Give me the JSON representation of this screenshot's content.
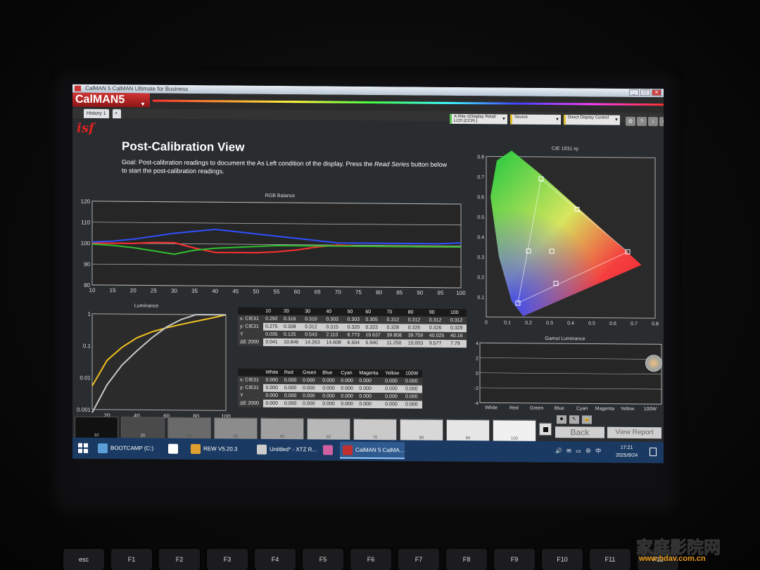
{
  "window": {
    "title": "CalMAN 5 CalMAN Ultimate for Business",
    "buttons": [
      "_",
      "□",
      "✕"
    ]
  },
  "logo": "CalMAN5",
  "tabs": [
    {
      "label": "History 1"
    },
    {
      "label": "+"
    }
  ],
  "toolbar": {
    "meter": "X-Rite i1Display Retail LCD (CCFL)",
    "source": "Source",
    "display": "Direct Display Control"
  },
  "isf_logo": "isf",
  "page_title": "Post-Calibration View",
  "goal": {
    "text_1": "Goal: Post-calibration readings to document the As Left condition of the display. Press the ",
    "em": "Read Series",
    "text_2": " button below to start the post-calibration readings."
  },
  "rgb_balance": {
    "title": "RGB Balance"
  },
  "luminance": {
    "title": "Luminance"
  },
  "cie": {
    "title": "CIE 1931 xy"
  },
  "gamut_luminance": {
    "title": "Gamut Luminance"
  },
  "chart_data": [
    {
      "type": "line",
      "title": "RGB Balance",
      "x": [
        10,
        15,
        20,
        25,
        30,
        35,
        40,
        45,
        50,
        55,
        60,
        65,
        70,
        75,
        80,
        85,
        90,
        95,
        100
      ],
      "ylim": [
        80,
        120
      ],
      "yticks": [
        80,
        90,
        100,
        110,
        120
      ],
      "grid": true,
      "series": [
        {
          "color": "#ff3030",
          "values": [
            100,
            100,
            100,
            100.5,
            100.5,
            98,
            96,
            96,
            96,
            96.5,
            97.5,
            99,
            100,
            99.5,
            99.5,
            99.5,
            99.5,
            99.5,
            99.5
          ]
        },
        {
          "color": "#30c030",
          "values": [
            99.5,
            99,
            98,
            96.5,
            95,
            97,
            98,
            98.5,
            99,
            99.5,
            99.5,
            99.5,
            99.5,
            99.5,
            99.5,
            99.5,
            99.5,
            99.5,
            99.5
          ]
        },
        {
          "color": "#3050ff",
          "values": [
            100.5,
            101,
            102,
            103.5,
            105,
            106,
            107,
            106,
            105,
            104,
            103,
            102,
            101,
            101,
            101,
            101,
            101,
            101,
            101.5
          ]
        }
      ]
    },
    {
      "type": "line",
      "title": "Luminance",
      "xlim": [
        10,
        100
      ],
      "xticks": [
        20,
        40,
        60,
        80,
        100
      ],
      "ylim": [
        0.001,
        1
      ],
      "yscale": "log",
      "yticks": [
        "0.001",
        "0.01",
        "0.1",
        "1"
      ],
      "series": [
        {
          "color": "#f0c020",
          "x": [
            10,
            20,
            30,
            40,
            50,
            60,
            70,
            80,
            90,
            100
          ],
          "values": [
            0.0055,
            0.035,
            0.09,
            0.18,
            0.28,
            0.38,
            0.49,
            0.62,
            0.78,
            1.0
          ]
        },
        {
          "color": "#c8c8c8",
          "x": [
            10,
            20,
            30,
            40,
            50,
            60,
            70,
            80,
            90,
            100
          ],
          "values": [
            0.0008,
            0.006,
            0.025,
            0.07,
            0.18,
            0.4,
            0.7,
            1.0,
            1.0,
            1.0
          ]
        }
      ]
    },
    {
      "type": "scatter",
      "title": "CIE 1931 xy",
      "xlim": [
        0,
        0.8
      ],
      "ylim": [
        0,
        0.8
      ],
      "xticks": [
        0,
        0.1,
        0.2,
        0.3,
        0.4,
        0.5,
        0.6,
        0.7,
        0.8
      ],
      "yticks": [
        0.1,
        0.2,
        0.3,
        0.4,
        0.5,
        0.6,
        0.7,
        0.8
      ],
      "points": [
        {
          "name": "R",
          "x": 0.67,
          "y": 0.33
        },
        {
          "name": "G",
          "x": 0.26,
          "y": 0.69
        },
        {
          "name": "B",
          "x": 0.15,
          "y": 0.07
        },
        {
          "name": "C",
          "x": 0.2,
          "y": 0.33
        },
        {
          "name": "M",
          "x": 0.33,
          "y": 0.17
        },
        {
          "name": "Y",
          "x": 0.43,
          "y": 0.54
        },
        {
          "name": "W",
          "x": 0.31,
          "y": 0.33
        }
      ]
    },
    {
      "type": "bar",
      "title": "Gamut Luminance",
      "categories": [
        "White",
        "Red",
        "Green",
        "Blue",
        "Cyan",
        "Magenta",
        "Yellow",
        "100W"
      ],
      "ylim": [
        -4,
        4
      ],
      "yticks": [
        -4,
        -2,
        0,
        2,
        4
      ],
      "values": [
        0,
        0,
        0,
        0,
        0,
        0,
        0,
        0
      ]
    }
  ],
  "grayscale_table": {
    "header": [
      "",
      "10",
      "20",
      "30",
      "40",
      "50",
      "60",
      "70",
      "80",
      "90",
      "100"
    ],
    "rows": [
      {
        "label": "x: CIE31",
        "style": "dk",
        "values": [
          "0.292",
          "0.316",
          "0.310",
          "0.303",
          "0.303",
          "0.305",
          "0.312",
          "0.312",
          "0.312",
          "0.312"
        ]
      },
      {
        "label": "y: CIE31",
        "style": "lt",
        "values": [
          "0.275",
          "0.308",
          "0.312",
          "0.315",
          "0.320",
          "0.323",
          "0.328",
          "0.326",
          "0.326",
          "0.329"
        ]
      },
      {
        "label": "Y",
        "style": "dk",
        "values": [
          "0.035",
          "0.125",
          "0.543",
          "2.110",
          "6.773",
          "19.637",
          "39.808",
          "39.759",
          "40.025",
          "40.16"
        ]
      },
      {
        "label": "ΔE 2000",
        "style": "lt",
        "values": [
          "3.041",
          "10.846",
          "14.263",
          "14.608",
          "6.504",
          "5.940",
          "11.250",
          "10.003",
          "9.577",
          "7.79"
        ]
      }
    ]
  },
  "color_table": {
    "header": [
      "",
      "White",
      "Red",
      "Green",
      "Blue",
      "Cyan",
      "Magenta",
      "Yellow",
      "100W"
    ],
    "rows": [
      {
        "label": "x: CIE31",
        "style": "dk",
        "values": [
          "0.000",
          "0.000",
          "0.000",
          "0.000",
          "0.000",
          "0.000",
          "0.000",
          "0.000"
        ]
      },
      {
        "label": "y: CIE31",
        "style": "lt",
        "values": [
          "0.000",
          "0.000",
          "0.000",
          "0.000",
          "0.000",
          "0.000",
          "0.000",
          "0.000"
        ]
      },
      {
        "label": "Y",
        "style": "dk",
        "values": [
          "0.000",
          "0.000",
          "0.000",
          "0.000",
          "0.000",
          "0.000",
          "0.000",
          "0.000"
        ]
      },
      {
        "label": "ΔE 2000",
        "style": "lt",
        "values": [
          "0.000",
          "0.000",
          "0.000",
          "0.000",
          "0.000",
          "0.000",
          "0.000",
          "0.000"
        ]
      }
    ]
  },
  "swatches": [
    {
      "label": "10",
      "color": "#111111"
    },
    {
      "label": "20",
      "color": "#4a4a4a"
    },
    {
      "label": "30",
      "color": "#6a6a6a"
    },
    {
      "label": "40",
      "color": "#8c8c8c"
    },
    {
      "label": "50",
      "color": "#a0a0a0"
    },
    {
      "label": "60",
      "color": "#b8b8b8"
    },
    {
      "label": "70",
      "color": "#cacaca"
    },
    {
      "label": "80",
      "color": "#d8d8d8"
    },
    {
      "label": "90",
      "color": "#e6e6e6"
    },
    {
      "label": "100",
      "color": "#f0f0f0"
    }
  ],
  "nav": {
    "back": "Back",
    "view_report": "View Report"
  },
  "taskbar": {
    "items": [
      {
        "label": "BOOTCAMP (C:)",
        "color": "#5a9fd8"
      },
      {
        "label": "",
        "color": "#ffffff"
      },
      {
        "label": "REW V5.20.3",
        "color": "#e0a030"
      },
      {
        "label": "Untitled* - XTZ R...",
        "color": "#cccccc"
      },
      {
        "label": "",
        "color": "#d060a0"
      },
      {
        "label": "CalMAN 5 CalMA...",
        "color": "#c03030"
      }
    ],
    "tray_lang": "中",
    "time": "17:21",
    "date": "2025/9/24"
  },
  "keyboard": {
    "keys": [
      "esc",
      "F1",
      "F2",
      "F3",
      "F4",
      "F5",
      "F6",
      "F7",
      "F8",
      "F9",
      "F10",
      "F11",
      "F12"
    ]
  },
  "watermark": {
    "main": "家庭影院网",
    "url": "www.hdav.com.cn"
  }
}
